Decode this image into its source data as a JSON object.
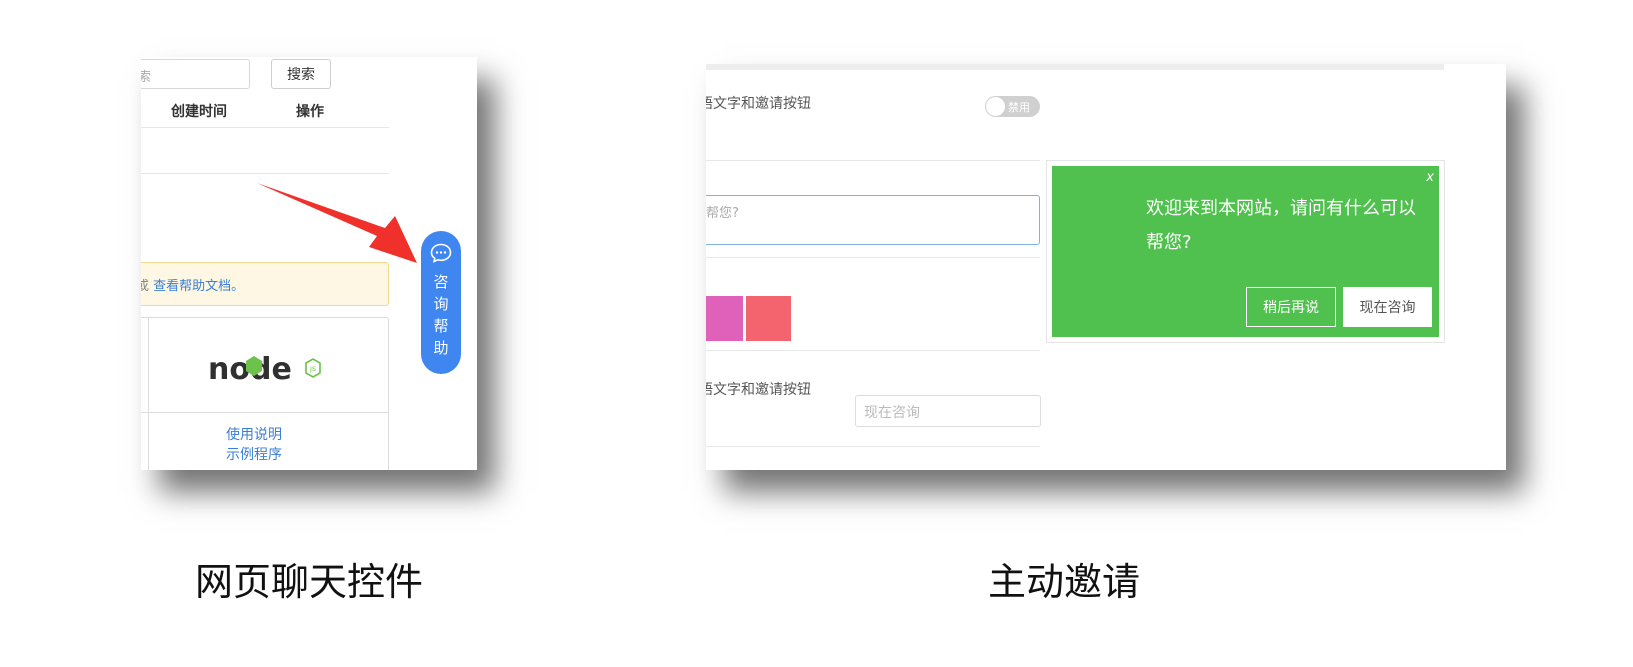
{
  "left_panel": {
    "search_placeholder": "索",
    "search_button": "搜索",
    "columns": [
      "创建时间",
      "操作"
    ],
    "help_tip": {
      "prefix": "或",
      "link": "查看帮助文档",
      "suffix": "。"
    },
    "card": {
      "logo_text": "node",
      "logo_badge": "JS",
      "links": [
        "使用说明",
        "示例程序"
      ]
    },
    "chat_widget": {
      "chars": [
        "咨",
        "询",
        "帮",
        "助"
      ]
    },
    "arrow_color": "#f0302a",
    "widget_color": "#3f86f1"
  },
  "right_panel": {
    "row1_label": "语文字和邀请按钮",
    "toggle_text": "禁用",
    "textarea_text": "帮您?",
    "swatches": [
      "#e061b9",
      "#f4646f"
    ],
    "row4_label": "语文字和邀请按钮",
    "input_placeholder": "现在咨询",
    "invite": {
      "close": "x",
      "message": "欢迎来到本网站，请问有什么可以帮您?",
      "later_button": "稍后再说",
      "now_button": "现在咨询",
      "color": "#50c14e"
    }
  },
  "captions": {
    "left": "网页聊天控件",
    "right": "主动邀请"
  }
}
